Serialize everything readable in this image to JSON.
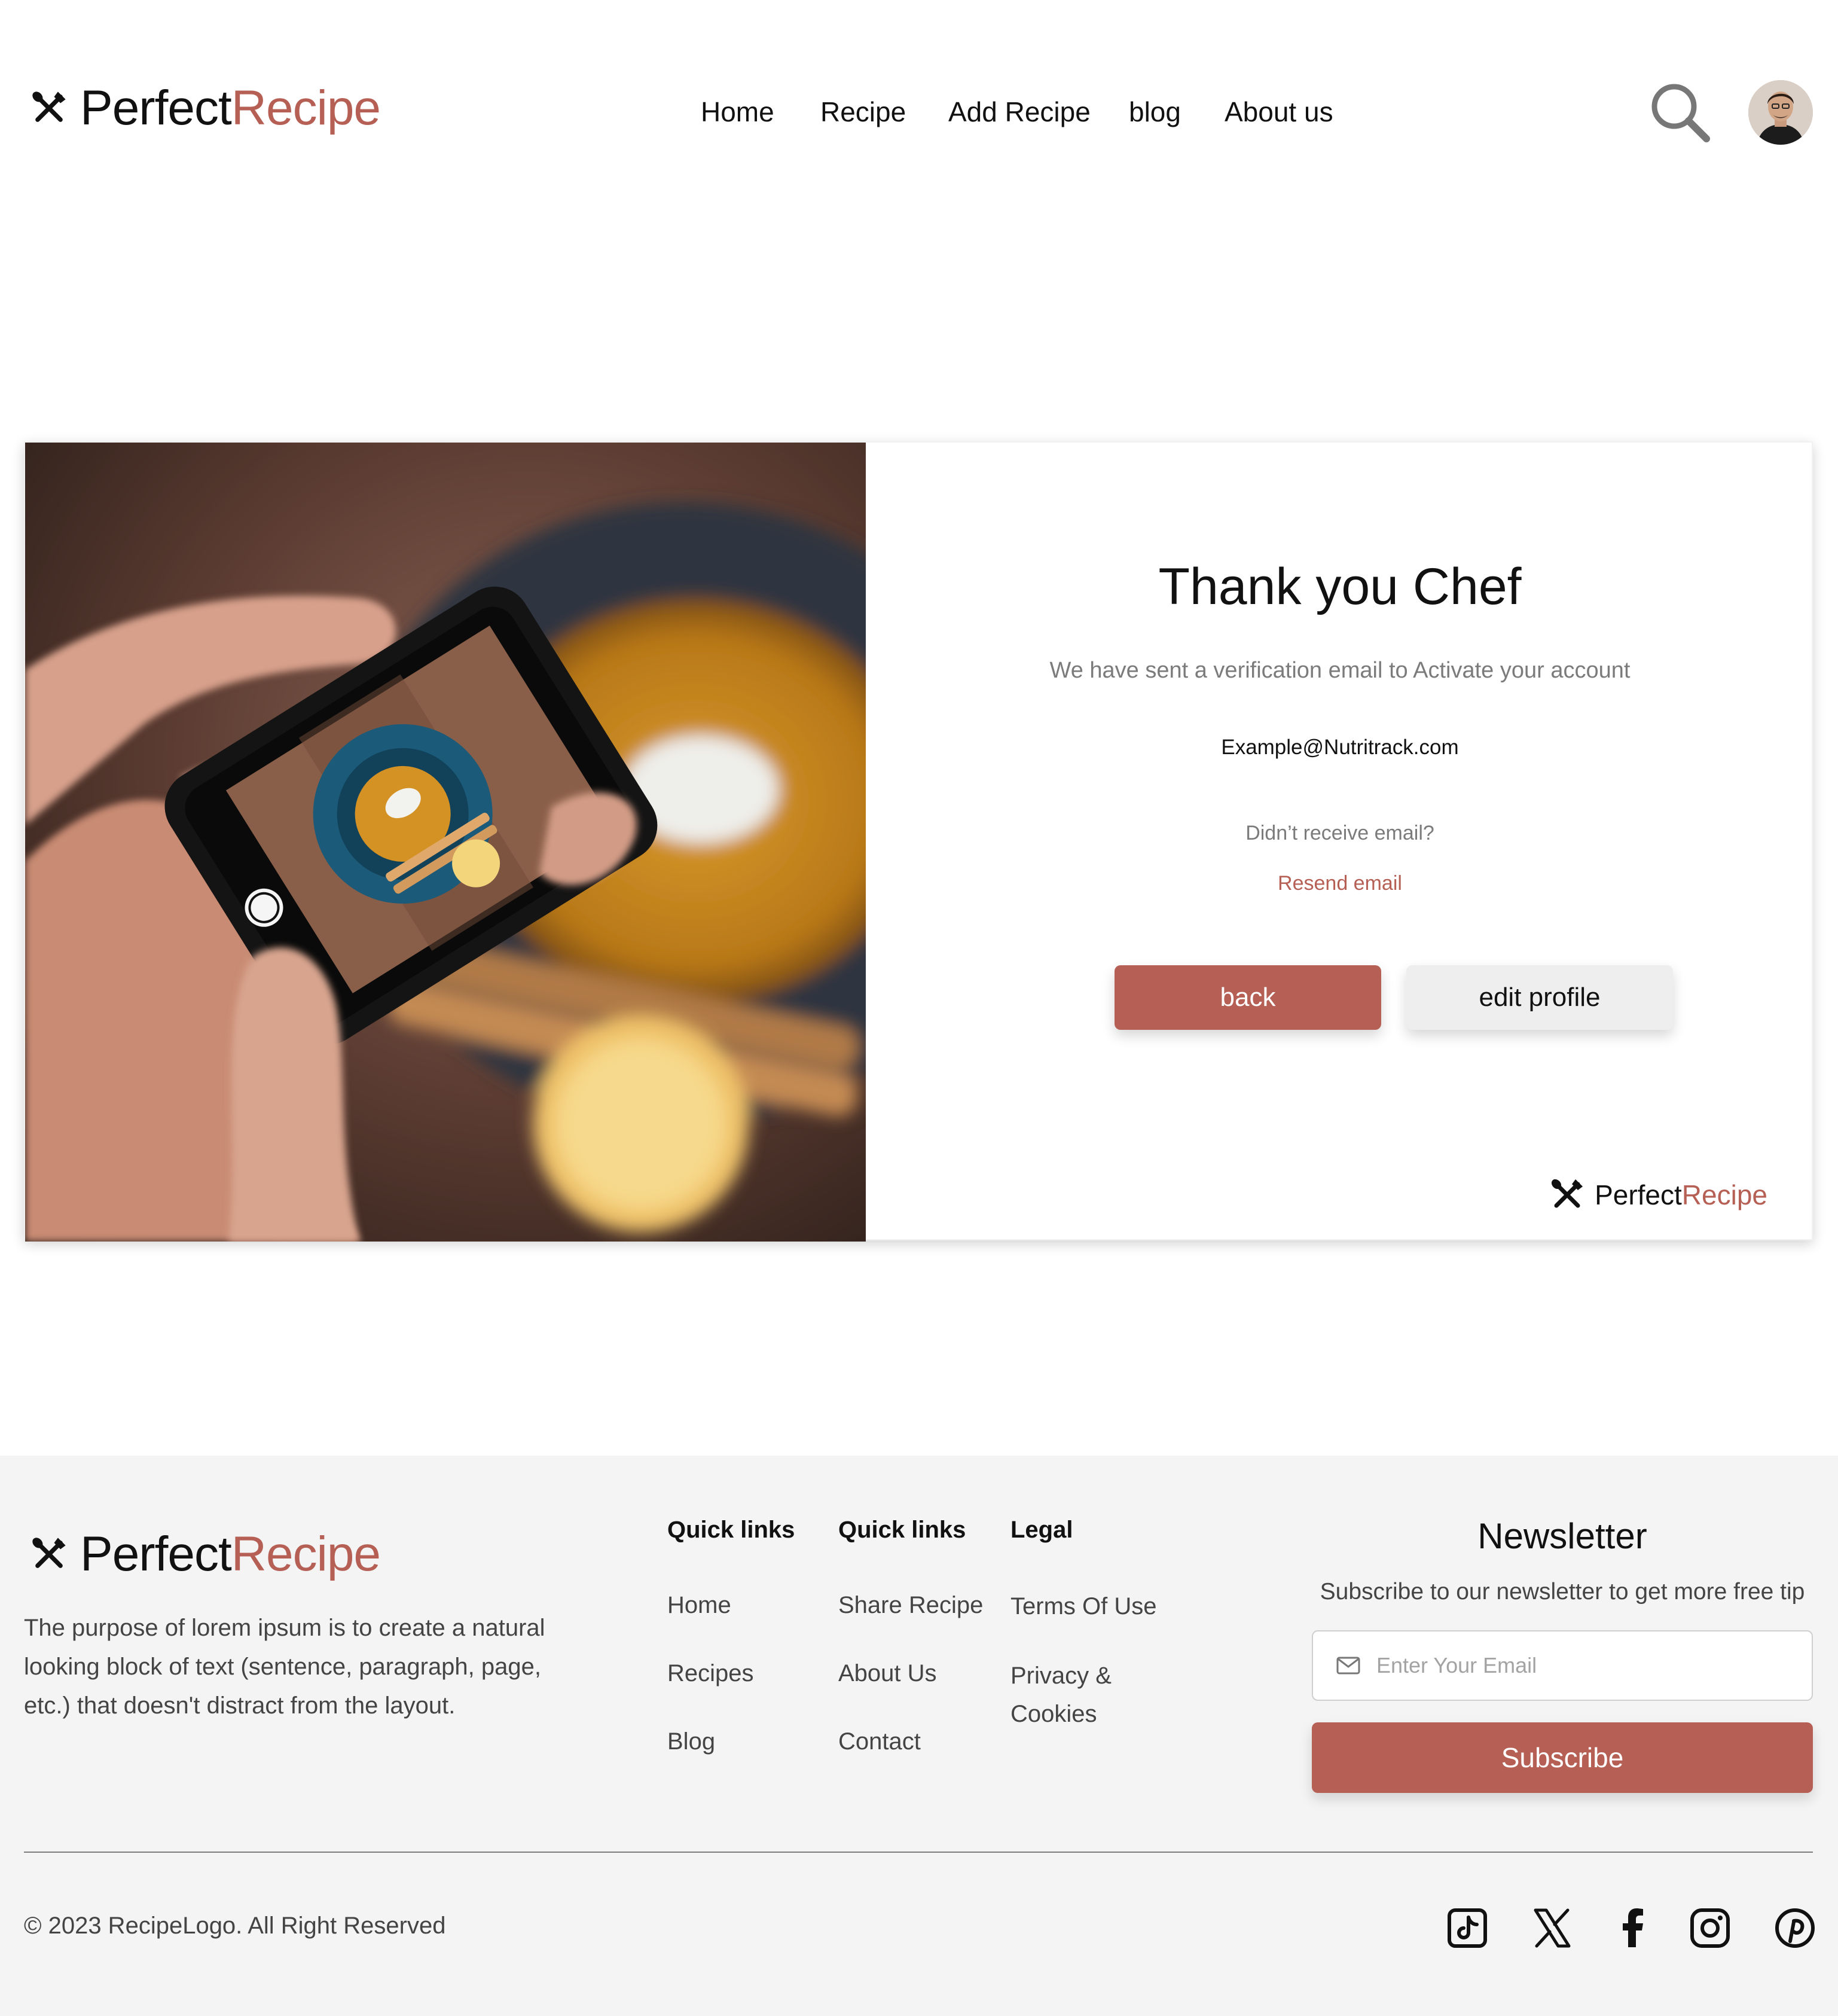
{
  "brand": {
    "word1": "Perfect",
    "word2": "Recipe",
    "accent": "#b65f54"
  },
  "header": {
    "nav": [
      "Home",
      "Recipe",
      "Add Recipe",
      "blog",
      "About us"
    ],
    "search_icon": "search-icon",
    "avatar_icon": "user-avatar"
  },
  "card": {
    "title": "Thank you Chef",
    "subtitle": "We have sent a verification email to Activate your account",
    "email": "Example@Nutritrack.com",
    "no_email": "Didn’t receive email?",
    "resend": "Resend email",
    "back_label": "back",
    "edit_label": "edit profile"
  },
  "footer": {
    "about": "The purpose of lorem ipsum is to create a natural looking block of text (sentence, paragraph, page, etc.) that doesn't distract from the layout.",
    "columns": [
      {
        "heading": "Quick links",
        "links": [
          "Home",
          "Recipes",
          "Blog"
        ]
      },
      {
        "heading": "Quick links",
        "links": [
          "Share Recipe",
          "About Us",
          "Contact"
        ]
      },
      {
        "heading": "Legal",
        "links": [
          "Terms Of Use",
          "Privacy &",
          "Cookies"
        ]
      }
    ],
    "newsletter": {
      "title": "Newsletter",
      "subtitle": "Subscribe to our newsletter to get more free tip",
      "placeholder": "Enter Your Email",
      "button": "Subscribe"
    },
    "copyright": "© 2023 RecipeLogo. All Right Reserved",
    "social_icons": [
      "tiktok-icon",
      "x-icon",
      "facebook-icon",
      "instagram-icon",
      "pinterest-icon"
    ]
  }
}
